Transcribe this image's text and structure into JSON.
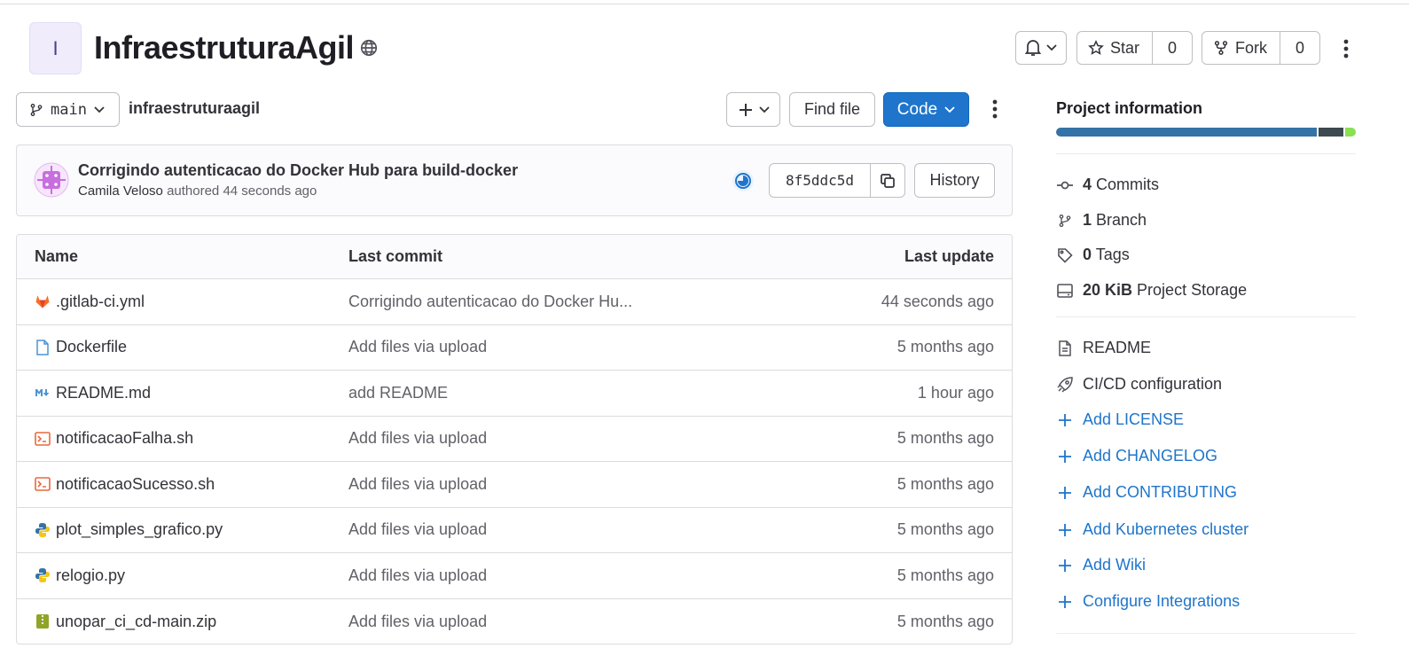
{
  "project": {
    "avatar_letter": "I",
    "name": "InfraestruturaAgil",
    "visibility_icon": "globe-icon"
  },
  "header_actions": {
    "star_label": "Star",
    "star_count": "0",
    "fork_label": "Fork",
    "fork_count": "0"
  },
  "repo_toolbar": {
    "branch": "main",
    "path": "infraestruturaagil",
    "find_file_label": "Find file",
    "code_label": "Code"
  },
  "last_commit": {
    "title": "Corrigindo autenticacao do Docker Hub para build-docker",
    "author": "Camila Veloso",
    "authored_text": "authored 44 seconds ago",
    "sha": "8f5ddc5d",
    "history_label": "History"
  },
  "file_table": {
    "headers": {
      "name": "Name",
      "last_commit": "Last commit",
      "last_update": "Last update"
    },
    "rows": [
      {
        "name": ".gitlab-ci.yml",
        "icon": "gitlab-icon",
        "commit": "Corrigindo autenticacao do Docker Hu...",
        "updated": "44 seconds ago"
      },
      {
        "name": "Dockerfile",
        "icon": "file-icon",
        "commit": "Add files via upload",
        "updated": "5 months ago"
      },
      {
        "name": "README.md",
        "icon": "markdown-icon",
        "commit": "add README",
        "updated": "1 hour ago"
      },
      {
        "name": "notificacaoFalha.sh",
        "icon": "terminal-icon",
        "commit": "Add files via upload",
        "updated": "5 months ago"
      },
      {
        "name": "notificacaoSucesso.sh",
        "icon": "terminal-icon",
        "commit": "Add files via upload",
        "updated": "5 months ago"
      },
      {
        "name": "plot_simples_grafico.py",
        "icon": "python-icon",
        "commit": "Add files via upload",
        "updated": "5 months ago"
      },
      {
        "name": "relogio.py",
        "icon": "python-icon",
        "commit": "Add files via upload",
        "updated": "5 months ago"
      },
      {
        "name": "unopar_ci_cd-main.zip",
        "icon": "zip-icon",
        "commit": "Add files via upload",
        "updated": "5 months ago"
      }
    ]
  },
  "sidebar": {
    "title": "Project information",
    "language_bar_colors": [
      "#3572a5",
      "#3d4a4f",
      "#89e051"
    ],
    "language_bar_shares": [
      0.88,
      0.085,
      0.035
    ],
    "stats": [
      {
        "count": "4",
        "label": "Commits",
        "icon": "commit-icon"
      },
      {
        "count": "1",
        "label": "Branch",
        "icon": "branch-icon"
      },
      {
        "count": "0",
        "label": "Tags",
        "icon": "tag-icon"
      },
      {
        "count": "20 KiB",
        "label": "Project Storage",
        "icon": "storage-icon"
      }
    ],
    "docs": [
      {
        "label": "README",
        "icon": "document-icon"
      },
      {
        "label": "CI/CD configuration",
        "icon": "rocket-icon"
      }
    ],
    "add_links": [
      "Add LICENSE",
      "Add CHANGELOG",
      "Add CONTRIBUTING",
      "Add Kubernetes cluster",
      "Add Wiki",
      "Configure Integrations"
    ]
  },
  "colors": {
    "primary_button": "#1f75cb",
    "link": "#1f75cb",
    "border": "#dcdcde"
  }
}
